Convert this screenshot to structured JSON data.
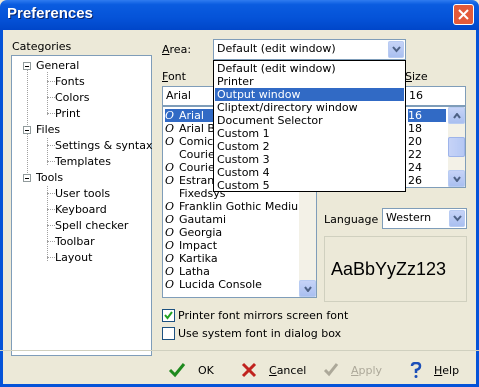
{
  "window": {
    "title": "Preferences"
  },
  "categories": {
    "label": "Categories",
    "groups": [
      {
        "name": "General",
        "children": [
          "Fonts",
          "Colors",
          "Print"
        ]
      },
      {
        "name": "Files",
        "children": [
          "Settings & syntax",
          "Templates"
        ]
      },
      {
        "name": "Tools",
        "children": [
          "User tools",
          "Keyboard",
          "Spell checker",
          "Toolbar",
          "Layout"
        ]
      }
    ],
    "selected": "Fonts"
  },
  "area": {
    "label": "Area:",
    "value": "Default (edit window)",
    "options": [
      "Default (edit window)",
      "Printer",
      "Output window",
      "Cliptext/directory window",
      "Document Selector",
      "Custom 1",
      "Custom 2",
      "Custom 3",
      "Custom 4",
      "Custom 5"
    ],
    "highlighted": "Output window"
  },
  "font": {
    "label": "Font",
    "value": "Arial",
    "items": [
      {
        "name": "Arial",
        "truetype": true,
        "selected": true
      },
      {
        "name": "Arial Bl",
        "truetype": true
      },
      {
        "name": "Comic S",
        "truetype": true
      },
      {
        "name": "Courie",
        "truetype": false
      },
      {
        "name": "Courie",
        "truetype": true
      },
      {
        "name": "Estran",
        "truetype": true
      },
      {
        "name": "Fixedsys",
        "truetype": false
      },
      {
        "name": "Franklin Gothic Medium",
        "truetype": true
      },
      {
        "name": "Gautami",
        "truetype": true
      },
      {
        "name": "Georgia",
        "truetype": true
      },
      {
        "name": "Impact",
        "truetype": true
      },
      {
        "name": "Kartika",
        "truetype": true
      },
      {
        "name": "Latha",
        "truetype": true
      },
      {
        "name": "Lucida Console",
        "truetype": true
      }
    ]
  },
  "size": {
    "label": "Size",
    "value": "16",
    "items": [
      "16",
      "18",
      "20",
      "22",
      "24",
      "26"
    ],
    "selected": "16"
  },
  "language": {
    "label": "Language :",
    "value": "Western"
  },
  "preview": {
    "text": "AaBbYyZz123"
  },
  "options": {
    "printer_mirrors": {
      "label": "Printer font mirrors screen font",
      "checked": true
    },
    "system_font": {
      "label": "Use system font in dialog box",
      "checked": false
    }
  },
  "buttons": {
    "ok": "OK",
    "cancel": "Cancel",
    "apply": "Apply",
    "help": "Help"
  },
  "icons": {
    "close": "close-icon",
    "ok": "checkmark-icon",
    "cancel": "x-icon",
    "apply": "checkmark-icon",
    "help": "question-mark-icon"
  }
}
